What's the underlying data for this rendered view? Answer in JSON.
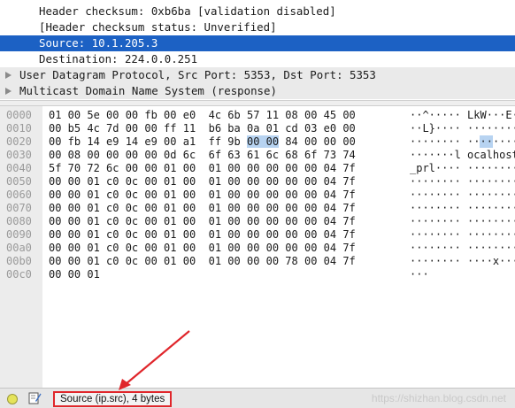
{
  "details": {
    "header_checksum": "Header checksum: 0xb6ba [validation disabled]",
    "checksum_status": "[Header checksum status: Unverified]",
    "source": "Source: 10.1.205.3",
    "destination": "Destination: 224.0.0.251",
    "udp": "User Datagram Protocol, Src Port: 5353, Dst Port: 5353",
    "mdns": "Multicast Domain Name System (response)"
  },
  "bytes": {
    "rows": [
      {
        "off": "0000",
        "hex": "01 00 5e 00 00 fb 00 e0  4c 6b 57 11 08 00 45 00",
        "ascii": "··^····· LkW···E·"
      },
      {
        "off": "0010",
        "hex": "00 b5 4c 7d 00 00 ff 11  b6 ba 0a 01 cd 03 e0 00",
        "ascii": "··L}···· ········"
      },
      {
        "off": "0020",
        "hex_pre": "00 fb 14 e9 14 e9 00 a1  ff 9b ",
        "hex_hl": "00 00",
        "hex_post": " 84 00 00 00",
        "ascii_pre": "········ ··",
        "ascii_hl": "··",
        "ascii_post": "····"
      },
      {
        "off": "0030",
        "hex": "00 08 00 00 00 00 0d 6c  6f 63 61 6c 68 6f 73 74",
        "ascii": "·······l ocalhost"
      },
      {
        "off": "0040",
        "hex": "5f 70 72 6c 00 00 01 00  01 00 00 00 00 00 04 7f",
        "ascii": "_prl···· ········"
      },
      {
        "off": "0050",
        "hex": "00 00 01 c0 0c 00 01 00  01 00 00 00 00 00 04 7f",
        "ascii": "········ ········"
      },
      {
        "off": "0060",
        "hex": "00 00 01 c0 0c 00 01 00  01 00 00 00 00 00 04 7f",
        "ascii": "········ ········"
      },
      {
        "off": "0070",
        "hex": "00 00 01 c0 0c 00 01 00  01 00 00 00 00 00 04 7f",
        "ascii": "········ ········"
      },
      {
        "off": "0080",
        "hex": "00 00 01 c0 0c 00 01 00  01 00 00 00 00 00 04 7f",
        "ascii": "········ ········"
      },
      {
        "off": "0090",
        "hex": "00 00 01 c0 0c 00 01 00  01 00 00 00 00 00 04 7f",
        "ascii": "········ ········"
      },
      {
        "off": "00a0",
        "hex": "00 00 01 c0 0c 00 01 00  01 00 00 00 00 00 04 7f",
        "ascii": "········ ········"
      },
      {
        "off": "00b0",
        "hex": "00 00 01 c0 0c 00 01 00  01 00 00 00 78 00 04 7f",
        "ascii": "········ ····x···"
      },
      {
        "off": "00c0",
        "hex": "00 00 01",
        "ascii": "···"
      }
    ]
  },
  "status": {
    "field": "Source (ip.src), 4 bytes",
    "watermark": "https://shizhan.blog.csdn.net"
  },
  "colors": {
    "selection": "#1c61c4",
    "byte_highlight": "#b7d3f1",
    "annotation": "#e0262b",
    "led": "#e5e35a"
  }
}
